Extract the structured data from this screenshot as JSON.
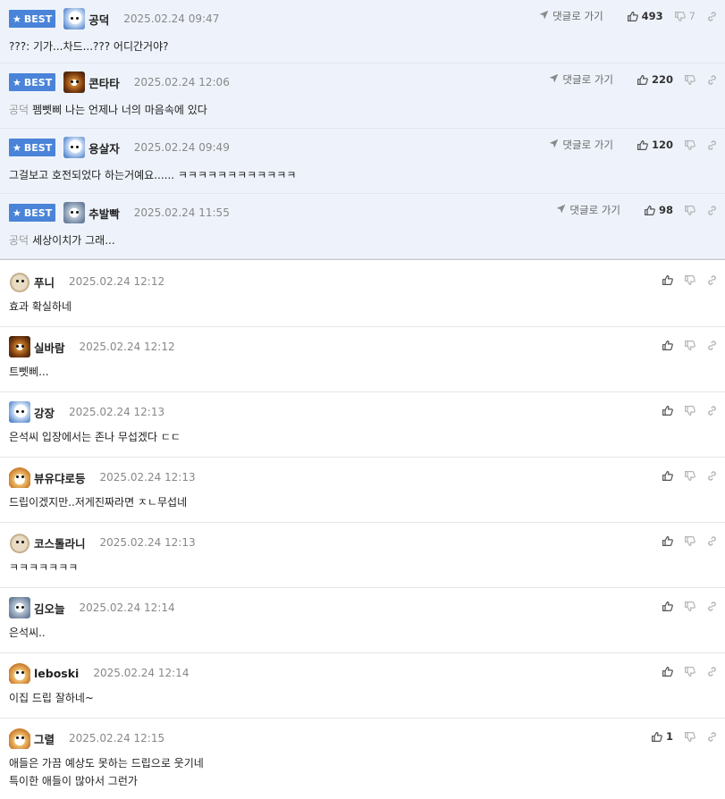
{
  "best_label": "BEST",
  "goto_label": "댓글로 가기",
  "best_comments": [
    {
      "nick": "공덕",
      "date": "2025.02.24 09:47",
      "category": "",
      "text": "???: 기가...차드...??? 어디간거야?",
      "likes": "493",
      "dislikes": "7"
    },
    {
      "nick": "콘타타",
      "date": "2025.02.24 12:06",
      "category": "공덕",
      "text": "펨뻿삐 나는 언제나 너의 마음속에 있다",
      "likes": "220",
      "dislikes": ""
    },
    {
      "nick": "용살자",
      "date": "2025.02.24 09:49",
      "category": "",
      "text": "그걸보고 호전되었다 하는거예요...... ㅋㅋㅋㅋㅋㅋㅋㅋㅋㅋㅋㅋ",
      "likes": "120",
      "dislikes": ""
    },
    {
      "nick": "추발빡",
      "date": "2025.02.24 11:55",
      "category": "공덕",
      "text": "세상이치가 그래...",
      "likes": "98",
      "dislikes": ""
    }
  ],
  "comments": [
    {
      "nick": "푸니",
      "date": "2025.02.24 12:12",
      "lines": [
        "효과 확실하네"
      ],
      "likes": ""
    },
    {
      "nick": "실바람",
      "date": "2025.02.24 12:12",
      "lines": [
        "트뻿삐..."
      ],
      "likes": ""
    },
    {
      "nick": "강장",
      "date": "2025.02.24 12:13",
      "lines": [
        "은석씨 입장에서는 존나 무섭겠다 ㄷㄷ"
      ],
      "likes": ""
    },
    {
      "nick": "뷰유댜로등",
      "date": "2025.02.24 12:13",
      "lines": [
        "드립이겠지만..저게진짜라면 ㅈㄴ무섭네"
      ],
      "likes": ""
    },
    {
      "nick": "코스톨라니",
      "date": "2025.02.24 12:13",
      "lines": [
        "ㅋㅋㅋㅋㅋㅋㅋ"
      ],
      "likes": ""
    },
    {
      "nick": "김오늘",
      "date": "2025.02.24 12:14",
      "lines": [
        "은석씨.."
      ],
      "likes": ""
    },
    {
      "nick": "leboski",
      "date": "2025.02.24 12:14",
      "lines": [
        "이집 드립 잘하네~"
      ],
      "likes": ""
    },
    {
      "nick": "그렬",
      "date": "2025.02.24 12:15",
      "lines": [
        "애들은 가끔 예상도 못하는 드립으로 웃기네",
        "특이한 애들이 많아서 그런가"
      ],
      "likes": "1"
    }
  ],
  "icons": {
    "like": "thumbs-up-icon",
    "dislike": "thumbs-down-icon",
    "link": "link-icon",
    "goto": "arrow-icon",
    "best": "star-icon"
  },
  "colors": {
    "best_bg": "#eef3fb",
    "badge": "#4a84d8"
  }
}
